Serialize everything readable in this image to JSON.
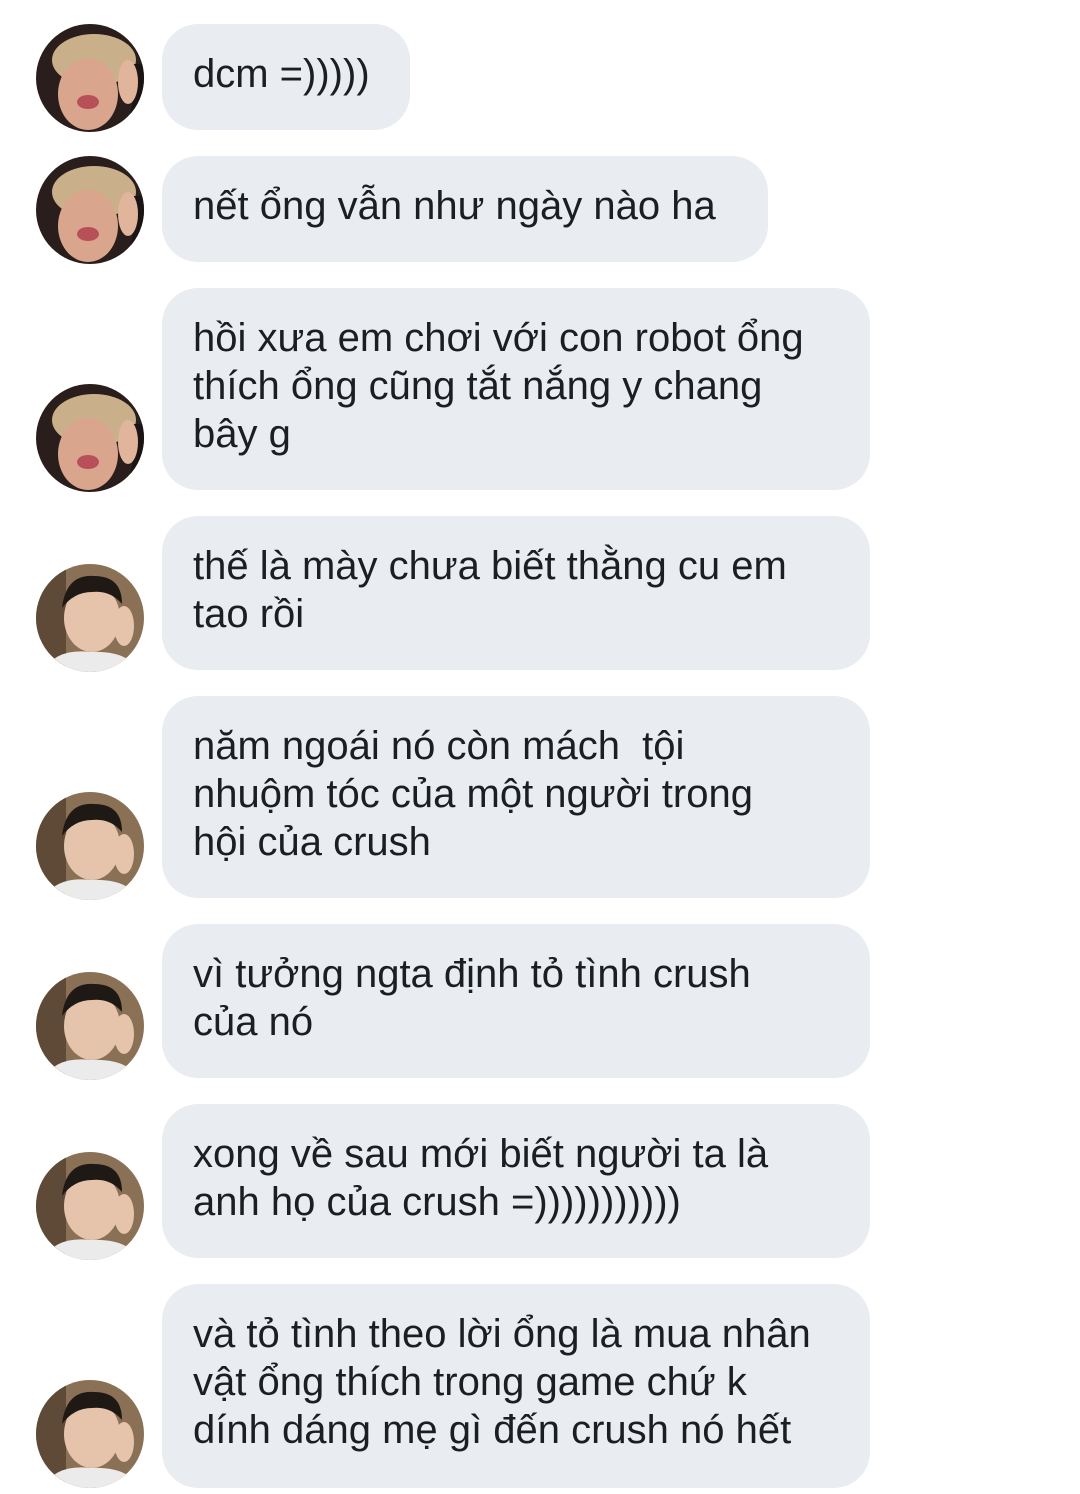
{
  "conversation": {
    "colors": {
      "bubble_background": "#e9ecf0",
      "text": "#1c1e21",
      "page_background": "#ffffff"
    },
    "messages": [
      {
        "sender": "friend",
        "avatar_icon": "blonde-person-avatar-icon",
        "lines": [
          "dcm =)))))"
        ]
      },
      {
        "sender": "friend",
        "avatar_icon": "blonde-person-avatar-icon",
        "lines": [
          "nết ổng vẫn như ngày nào ha"
        ]
      },
      {
        "sender": "friend",
        "avatar_icon": "blonde-person-avatar-icon",
        "lines": [
          "hồi xưa em chơi với con robot ổng",
          "thích ổng cũng tắt nắng y chang",
          "bây g"
        ]
      },
      {
        "sender": "other",
        "avatar_icon": "dark-hair-person-avatar-icon",
        "lines": [
          "thế là mày chưa biết thằng cu em",
          "tao rồi"
        ]
      },
      {
        "sender": "other",
        "avatar_icon": "dark-hair-person-avatar-icon",
        "lines": [
          "năm ngoái nó còn mách  tội",
          "nhuộm tóc của một người trong",
          "hội của crush"
        ]
      },
      {
        "sender": "other",
        "avatar_icon": "dark-hair-person-avatar-icon",
        "lines": [
          "vì tưởng ngta định tỏ tình crush",
          "của nó"
        ]
      },
      {
        "sender": "other",
        "avatar_icon": "dark-hair-person-avatar-icon",
        "lines": [
          "xong về sau mới biết người ta là",
          "anh họ của crush =)))))))))))"
        ]
      },
      {
        "sender": "other",
        "avatar_icon": "dark-hair-person-avatar-icon",
        "lines": [
          "và tỏ tình theo lời ổng là mua nhân",
          "vật ổng thích trong game chứ k",
          "dính dáng mẹ gì đến crush nó hết"
        ]
      }
    ]
  }
}
